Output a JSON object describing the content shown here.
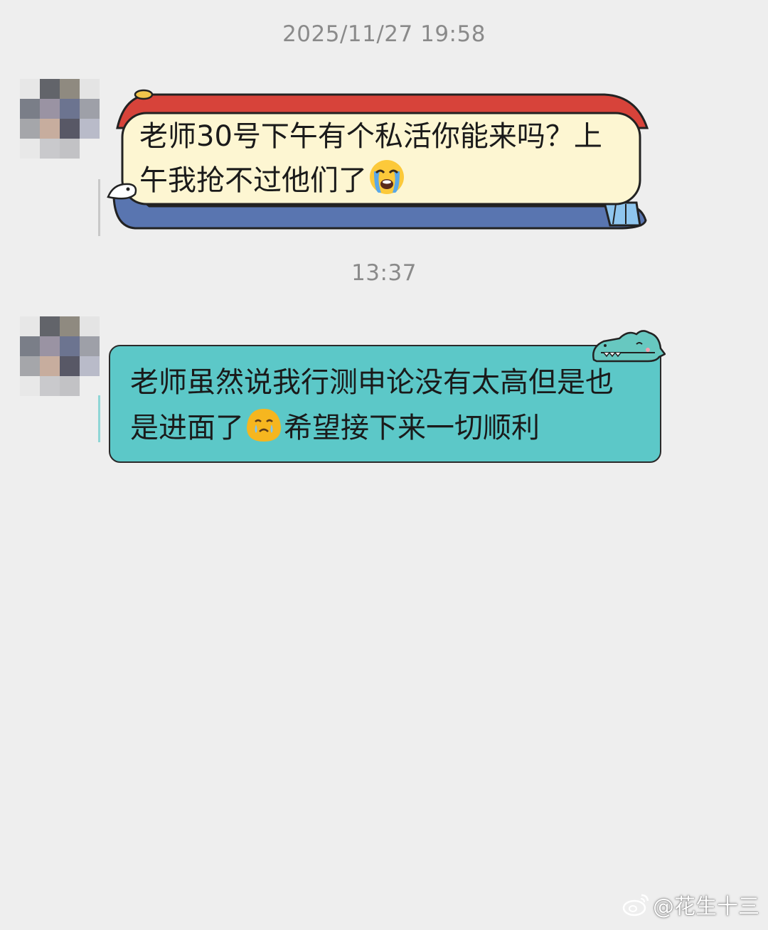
{
  "timestamps": {
    "first": "2025/11/27 19:58",
    "second": "13:37"
  },
  "messages": [
    {
      "line1": "老师30号下午有个私活你能来吗？上",
      "line2": "午我抢不过他们了",
      "emoji": "loudly-crying-face",
      "bubble_style": "scroll",
      "colors": {
        "top": "#d7433a",
        "body": "#fdf6d2",
        "bottom": "#5975b0",
        "tassel": "#8fc6ee"
      }
    },
    {
      "line1": "老师虽然说我行测申论没有太高但是也",
      "line2_before": "是进面了",
      "emoji": "crying-face-yellow",
      "line2_after": "希望接下来一切顺利",
      "bubble_style": "teal-crocodile",
      "colors": {
        "body": "#5cc8c8",
        "border": "#2a2a2a",
        "croc": "#67c8c0"
      }
    }
  ],
  "avatar": {
    "style": "pixelated",
    "icon": "blurred-avatar"
  },
  "watermark": {
    "icon": "weibo-icon",
    "text": "@花生十三"
  }
}
